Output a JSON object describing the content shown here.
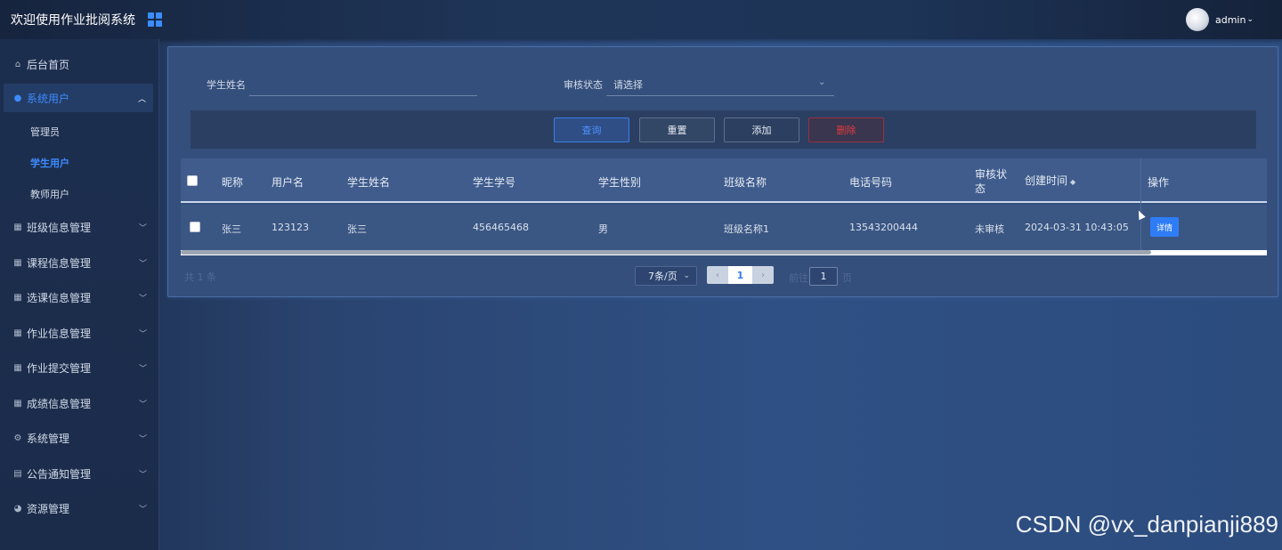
{
  "header": {
    "title": "欢迎使用作业批阅系统",
    "user": "admin"
  },
  "sidebar": {
    "items": [
      {
        "label": "后台首页",
        "icon": "home-icon"
      },
      {
        "label": "系统用户",
        "icon": "user-icon",
        "expanded": true,
        "children": [
          {
            "label": "管理员"
          },
          {
            "label": "学生用户",
            "active": true
          },
          {
            "label": "教师用户"
          }
        ]
      },
      {
        "label": "班级信息管理",
        "icon": "grid-icon"
      },
      {
        "label": "课程信息管理",
        "icon": "grid-icon"
      },
      {
        "label": "选课信息管理",
        "icon": "grid-icon"
      },
      {
        "label": "作业信息管理",
        "icon": "grid-icon"
      },
      {
        "label": "作业提交管理",
        "icon": "grid-icon"
      },
      {
        "label": "成绩信息管理",
        "icon": "grid-icon"
      },
      {
        "label": "系统管理",
        "icon": "gear-icon"
      },
      {
        "label": "公告通知管理",
        "icon": "document-icon"
      },
      {
        "label": "资源管理",
        "icon": "pie-chart-icon"
      }
    ]
  },
  "search": {
    "student_name_label": "学生姓名",
    "student_name_value": "",
    "review_status_label": "审核状态",
    "review_status_value": "请选择"
  },
  "actions": {
    "query": "查询",
    "reset": "重置",
    "add": "添加",
    "delete": "删除"
  },
  "table": {
    "columns": [
      "昵称",
      "用户名",
      "学生姓名",
      "学生学号",
      "学生性别",
      "班级名称",
      "电话号码",
      "审核状态",
      "创建时间",
      "操作"
    ],
    "review_status_col_line1": "审核状",
    "review_status_col_line2": "态",
    "rows": [
      {
        "nickname": "张三",
        "username": "123123",
        "student_name": "张三",
        "student_no": "456465468",
        "gender": "男",
        "class_name": "班级名称1",
        "phone": "13543200444",
        "status": "未审核",
        "created": "2024-03-31 10:43:05",
        "action": "详情"
      }
    ]
  },
  "pagination": {
    "total": "共 1 条",
    "page_size": "7条/页",
    "current_page": "1",
    "goto_label": "前往",
    "goto_value": "1",
    "goto_suffix": "页"
  },
  "watermark": "CSDN @vx_danpianji889",
  "colors": {
    "accent": "#3d8cff",
    "danger": "#e33b3b",
    "panel": "#344f7c"
  }
}
